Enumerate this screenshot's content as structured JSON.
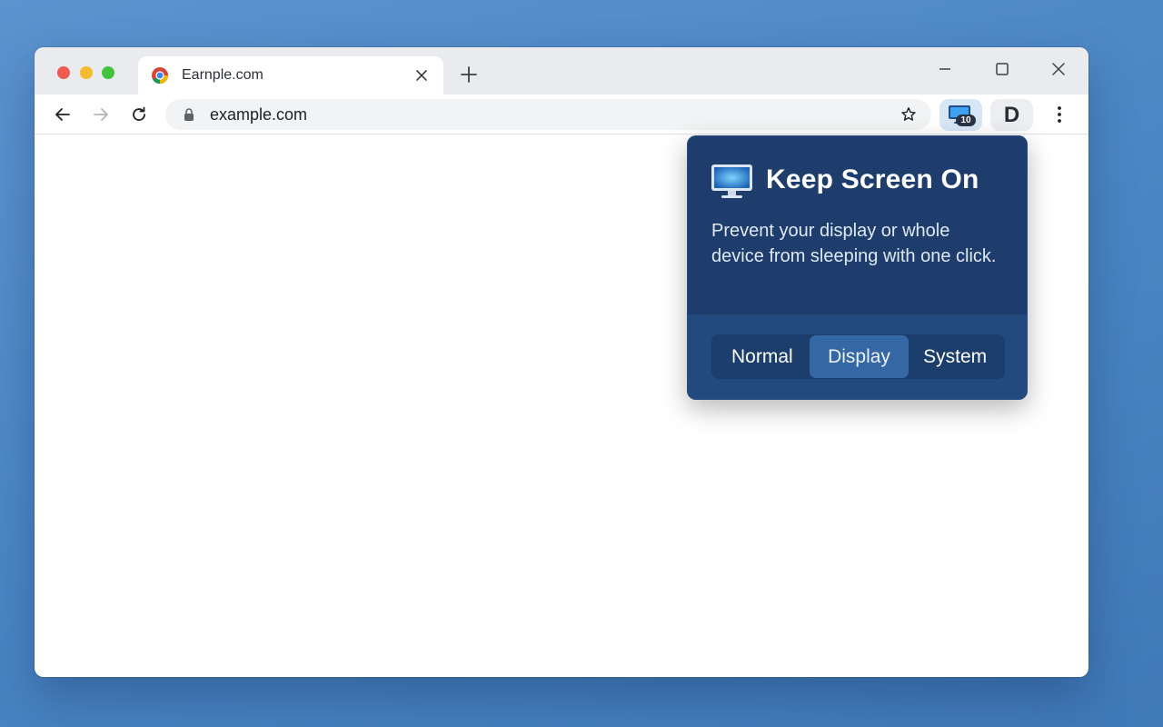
{
  "browser": {
    "tab": {
      "title": "Earnple.com",
      "favicon": "chrome-icon"
    },
    "address_bar": {
      "url": "example.com"
    },
    "extensions": {
      "keep_screen_on": {
        "icon": "monitor-icon",
        "badge": "10"
      },
      "d_extension": {
        "label": "D"
      }
    }
  },
  "popup": {
    "title": "Keep Screen On",
    "description": "Prevent your display or whole device from sleeping with one click.",
    "modes": [
      {
        "label": "Normal",
        "selected": false
      },
      {
        "label": "Display",
        "selected": true
      },
      {
        "label": "System",
        "selected": false
      }
    ]
  },
  "colors": {
    "popup_bg": "#1e3d6d",
    "popup_footer_bg": "#234a7e",
    "selected_mode_bg": "#3467a3",
    "extension_highlight": "#d7e6f7",
    "desktop_bg": "#4a86c5"
  }
}
